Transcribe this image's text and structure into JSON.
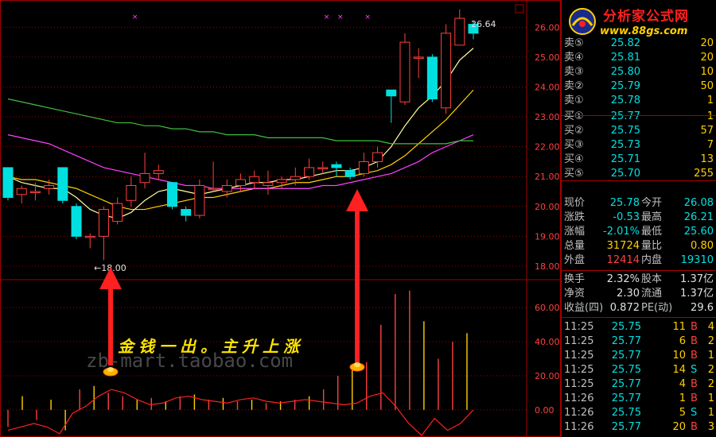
{
  "logo": {
    "title": "分析家公式网",
    "url": "www.88gs.com"
  },
  "annotation": {
    "text": "金钱一出。主升上涨",
    "watermark": "zb-mart.taobao.com"
  },
  "chart_labels": {
    "high_label": "26.64",
    "low_label": "←18.00"
  },
  "order_book": {
    "sell": [
      {
        "label": "卖⑤",
        "price": "25.82",
        "vol": "20"
      },
      {
        "label": "卖④",
        "price": "25.81",
        "vol": "20"
      },
      {
        "label": "卖③",
        "price": "25.80",
        "vol": "10"
      },
      {
        "label": "卖②",
        "price": "25.79",
        "vol": "50"
      },
      {
        "label": "卖①",
        "price": "25.78",
        "vol": "1"
      }
    ],
    "buy": [
      {
        "label": "买①",
        "price": "25.77",
        "vol": "1"
      },
      {
        "label": "买②",
        "price": "25.75",
        "vol": "57"
      },
      {
        "label": "买③",
        "price": "25.73",
        "vol": "7"
      },
      {
        "label": "买④",
        "price": "25.71",
        "vol": "13"
      },
      {
        "label": "买⑤",
        "price": "25.70",
        "vol": "255"
      }
    ]
  },
  "quote": {
    "rows": [
      {
        "l1": "现价",
        "v1": "25.78",
        "l2": "今开",
        "v2": "26.08"
      },
      {
        "l1": "涨跌",
        "v1": "-0.53",
        "l2": "最高",
        "v2": "26.21"
      },
      {
        "l1": "涨幅",
        "v1": "-2.01%",
        "l2": "最低",
        "v2": "25.60"
      },
      {
        "l1": "总量",
        "v1": "31724",
        "l2": "量比",
        "v2": "0.80"
      },
      {
        "l1": "外盘",
        "v1": "12414",
        "l2": "内盘",
        "v2": "19310"
      }
    ],
    "rows2": [
      {
        "l1": "换手",
        "v1": "2.32%",
        "l2": "股本",
        "v2": "1.37亿"
      },
      {
        "l1": "净资",
        "v1": "2.30",
        "l2": "流通",
        "v2": "1.37亿"
      },
      {
        "l1": "收益(四)",
        "v1": "0.872",
        "l2": "PE(动)",
        "v2": "29.6"
      }
    ]
  },
  "ticks": [
    {
      "time": "11:25",
      "price": "25.75",
      "vol": "11",
      "side": "B",
      "n": "4"
    },
    {
      "time": "11:25",
      "price": "25.77",
      "vol": "6",
      "side": "B",
      "n": "2"
    },
    {
      "time": "11:25",
      "price": "25.77",
      "vol": "10",
      "side": "B",
      "n": "1"
    },
    {
      "time": "11:25",
      "price": "25.75",
      "vol": "14",
      "side": "S",
      "n": "2"
    },
    {
      "time": "11:25",
      "price": "25.77",
      "vol": "4",
      "side": "B",
      "n": "2"
    },
    {
      "time": "11:26",
      "price": "25.77",
      "vol": "1",
      "side": "B",
      "n": "1"
    },
    {
      "time": "11:26",
      "price": "25.75",
      "vol": "5",
      "side": "S",
      "n": "1"
    },
    {
      "time": "11:26",
      "price": "25.77",
      "vol": "20",
      "side": "B",
      "n": "3"
    }
  ],
  "chart_data": {
    "type": "candlestick",
    "price_axis": {
      "ticks": [
        "26.00",
        "25.00",
        "24.00",
        "23.00",
        "22.00",
        "21.00",
        "20.00",
        "19.00",
        "18.00"
      ],
      "ylim": [
        17.6,
        26.7
      ]
    },
    "indicator_axis": {
      "ticks": [
        "60.00",
        "40.00",
        "20.00",
        "0.00"
      ],
      "ylim": [
        -15,
        75
      ]
    },
    "candles": [
      [
        21.3,
        20.3,
        21.3,
        20.2
      ],
      [
        20.4,
        20.6,
        20.7,
        20.1
      ],
      [
        20.5,
        20.5,
        20.8,
        20.2
      ],
      [
        20.6,
        20.7,
        20.9,
        20.4
      ],
      [
        21.3,
        20.2,
        21.3,
        20.1
      ],
      [
        20.0,
        19.0,
        20.1,
        18.9
      ],
      [
        19.0,
        19.0,
        19.1,
        18.6
      ],
      [
        19.0,
        19.9,
        20.0,
        18.2
      ],
      [
        19.5,
        20.1,
        20.3,
        19.4
      ],
      [
        20.2,
        20.7,
        21.0,
        20.0
      ],
      [
        20.8,
        21.1,
        21.8,
        20.6
      ],
      [
        21.1,
        21.2,
        21.4,
        20.9
      ],
      [
        20.8,
        20.0,
        20.8,
        19.9
      ],
      [
        19.9,
        19.7,
        20.0,
        19.5
      ],
      [
        19.7,
        20.7,
        20.9,
        19.6
      ],
      [
        20.6,
        20.6,
        21.5,
        20.5
      ],
      [
        20.5,
        20.7,
        20.9,
        20.3
      ],
      [
        20.7,
        20.9,
        21.1,
        20.5
      ],
      [
        20.8,
        21.0,
        21.2,
        20.6
      ],
      [
        20.7,
        20.8,
        21.2,
        20.4
      ],
      [
        20.8,
        20.9,
        21.0,
        20.6
      ],
      [
        20.9,
        21.0,
        21.3,
        20.7
      ],
      [
        21.0,
        21.3,
        21.6,
        20.9
      ],
      [
        21.3,
        21.3,
        21.5,
        21.1
      ],
      [
        21.4,
        21.3,
        21.5,
        21.0
      ],
      [
        21.2,
        21.0,
        21.3,
        20.9
      ],
      [
        21.1,
        21.5,
        21.8,
        21.0
      ],
      [
        21.5,
        21.8,
        22.0,
        21.3
      ],
      [
        23.9,
        23.7,
        23.9,
        22.8
      ],
      [
        23.5,
        25.5,
        25.8,
        23.4
      ],
      [
        25.0,
        25.0,
        25.3,
        24.3
      ],
      [
        25.0,
        23.6,
        25.1,
        23.5
      ],
      [
        23.3,
        25.8,
        26.1,
        23.1
      ],
      [
        25.4,
        26.3,
        26.6,
        25.4
      ],
      [
        26.1,
        25.8,
        26.2,
        25.6
      ]
    ],
    "ma_series": [
      {
        "color": "#ffffa0",
        "values": [
          21.0,
          20.8,
          20.7,
          20.6,
          20.6,
          20.3,
          19.9,
          19.7,
          19.6,
          19.8,
          20.2,
          20.5,
          20.6,
          20.5,
          20.4,
          20.5,
          20.6,
          20.7,
          20.8,
          20.8,
          20.9,
          20.9,
          21.0,
          21.1,
          21.2,
          21.2,
          21.3,
          21.5,
          22.0,
          22.7,
          23.3,
          23.7,
          24.2,
          24.9,
          25.3
        ]
      },
      {
        "color": "#ffd000",
        "values": [
          21.0,
          20.9,
          20.9,
          20.8,
          20.7,
          20.6,
          20.4,
          20.2,
          20.0,
          19.9,
          19.9,
          20.0,
          20.1,
          20.2,
          20.3,
          20.3,
          20.4,
          20.5,
          20.6,
          20.6,
          20.7,
          20.8,
          20.8,
          20.9,
          21.0,
          21.0,
          21.1,
          21.2,
          21.4,
          21.7,
          22.1,
          22.5,
          22.9,
          23.4,
          23.9
        ]
      },
      {
        "color": "#ff40ff",
        "values": [
          22.4,
          22.3,
          22.2,
          22.1,
          21.9,
          21.7,
          21.5,
          21.3,
          21.2,
          21.1,
          21.0,
          20.9,
          20.8,
          20.7,
          20.7,
          20.6,
          20.6,
          20.6,
          20.6,
          20.6,
          20.6,
          20.6,
          20.6,
          20.7,
          20.7,
          20.8,
          20.9,
          21.0,
          21.1,
          21.3,
          21.5,
          21.8,
          22.0,
          22.2,
          22.4
        ]
      },
      {
        "color": "#40c040",
        "values": [
          23.6,
          23.5,
          23.4,
          23.3,
          23.2,
          23.1,
          23.0,
          22.9,
          22.8,
          22.8,
          22.7,
          22.7,
          22.6,
          22.6,
          22.5,
          22.5,
          22.4,
          22.4,
          22.4,
          22.3,
          22.3,
          22.3,
          22.3,
          22.3,
          22.2,
          22.2,
          22.2,
          22.2,
          22.1,
          22.1,
          22.1,
          22.1,
          22.1,
          22.2,
          22.2
        ]
      }
    ],
    "indicator_line": [
      -12,
      -10,
      -8,
      -10,
      -14,
      -2,
      2,
      8,
      12,
      10,
      6,
      3,
      4,
      7,
      8,
      6,
      5,
      4,
      6,
      7,
      5,
      4,
      5,
      6,
      5,
      4,
      3,
      4,
      8,
      10,
      2,
      -8,
      -15,
      -5,
      -12,
      -8,
      0
    ],
    "indicator_bars": [
      {
        "color": "#ff4040",
        "value": -10
      },
      {
        "color": "#ffd000",
        "value": 8
      },
      {
        "color": "#ff4040",
        "value": -6
      },
      {
        "color": "#ffd000",
        "value": 6
      },
      {
        "color": "#ffd000",
        "value": -12
      },
      {
        "color": "#ff4040",
        "value": 12
      },
      {
        "color": "#ffd000",
        "value": 14
      },
      {
        "color": "#ff4040",
        "value": 10
      },
      {
        "color": "#ff4040",
        "value": 8
      },
      {
        "color": "#ffd000",
        "value": 6
      },
      {
        "color": "#ff4040",
        "value": 7
      },
      {
        "color": "#ffd000",
        "value": 5
      },
      {
        "color": "#ff4040",
        "value": 8
      },
      {
        "color": "#ffd000",
        "value": 9
      },
      {
        "color": "#ff4040",
        "value": 6
      },
      {
        "color": "#ffd000",
        "value": 7
      },
      {
        "color": "#ff4040",
        "value": 5
      },
      {
        "color": "#ffd000",
        "value": 6
      },
      {
        "color": "#ff4040",
        "value": 4
      },
      {
        "color": "#ffd000",
        "value": 5
      },
      {
        "color": "#ff4040",
        "value": 6
      },
      {
        "color": "#ffd000",
        "value": 8
      },
      {
        "color": "#ff4040",
        "value": 12
      },
      {
        "color": "#ff4040",
        "value": 20
      },
      {
        "color": "#ffd000",
        "value": 24
      },
      {
        "color": "#ff4040",
        "value": 28
      },
      {
        "color": "#ff4040",
        "value": 50
      },
      {
        "color": "#ff4040",
        "value": 68
      },
      {
        "color": "#ff4040",
        "value": 70
      },
      {
        "color": "#ffd000",
        "value": 52
      },
      {
        "color": "#ff4040",
        "value": 30
      },
      {
        "color": "#ff4040",
        "value": 40
      },
      {
        "color": "#ffd000",
        "value": 45
      }
    ],
    "x_markers": [
      9,
      23,
      24,
      26
    ]
  },
  "colors": {
    "up": "#ff4040",
    "down": "#00e0e0",
    "grid": "#a00000",
    "axis_text": "#ff4040"
  }
}
